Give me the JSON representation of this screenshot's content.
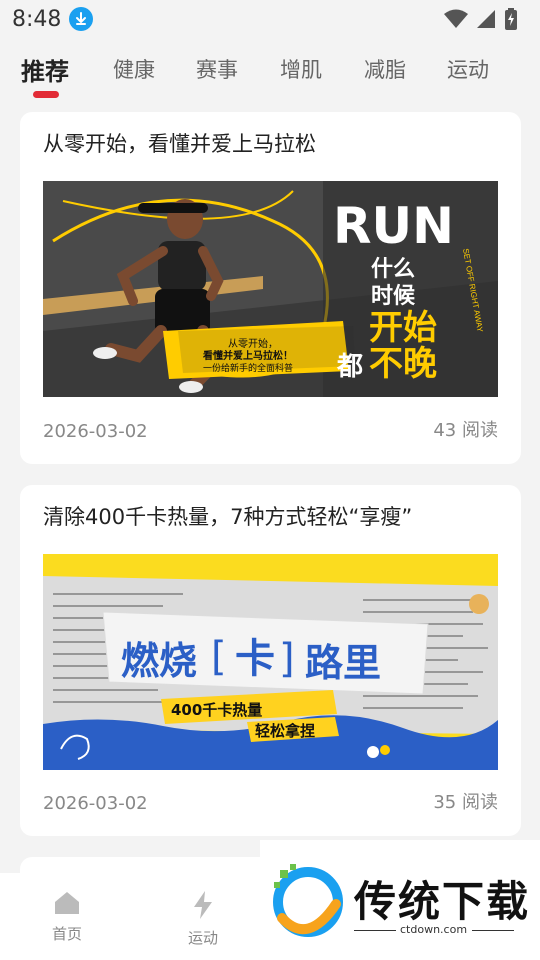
{
  "status_bar": {
    "time": "8:48"
  },
  "tabs": [
    {
      "label": "推荐",
      "active": true
    },
    {
      "label": "健康"
    },
    {
      "label": "赛事"
    },
    {
      "label": "增肌"
    },
    {
      "label": "减脂"
    },
    {
      "label": "运动"
    }
  ],
  "articles": [
    {
      "title": "从零开始，看懂并爱上马拉松",
      "date": "2026-03-02",
      "reads": "43 阅读",
      "image_text": {
        "big": "RUN",
        "line1": "什么",
        "line2": "时候",
        "line3": "开始",
        "line4_a": "都",
        "line4_b": "不晚",
        "side": "SET OFF RIGHT AWAY",
        "banner1": "从零开始，",
        "banner2": "看懂并爱上马拉松！",
        "banner3": "一份给新手的全面科普"
      }
    },
    {
      "title": "清除400千卡热量，7种方式轻松“享瘦”",
      "date": "2026-03-02",
      "reads": "35 阅读",
      "image_text": {
        "headline_a": "燃烧",
        "headline_b": "卡",
        "headline_c": "路里",
        "sub1": "400千卡热量",
        "sub2": "轻松拿捏"
      }
    }
  ],
  "bottom_nav": [
    {
      "label": "首页",
      "icon": "home-icon"
    },
    {
      "label": "运动",
      "icon": "lightning-icon"
    }
  ],
  "watermark": {
    "title": "传统下载",
    "url": "ctdown.com"
  },
  "colors": {
    "accent": "#e22b36",
    "yellow": "#ffcc00",
    "blue": "#2b5fc6"
  }
}
